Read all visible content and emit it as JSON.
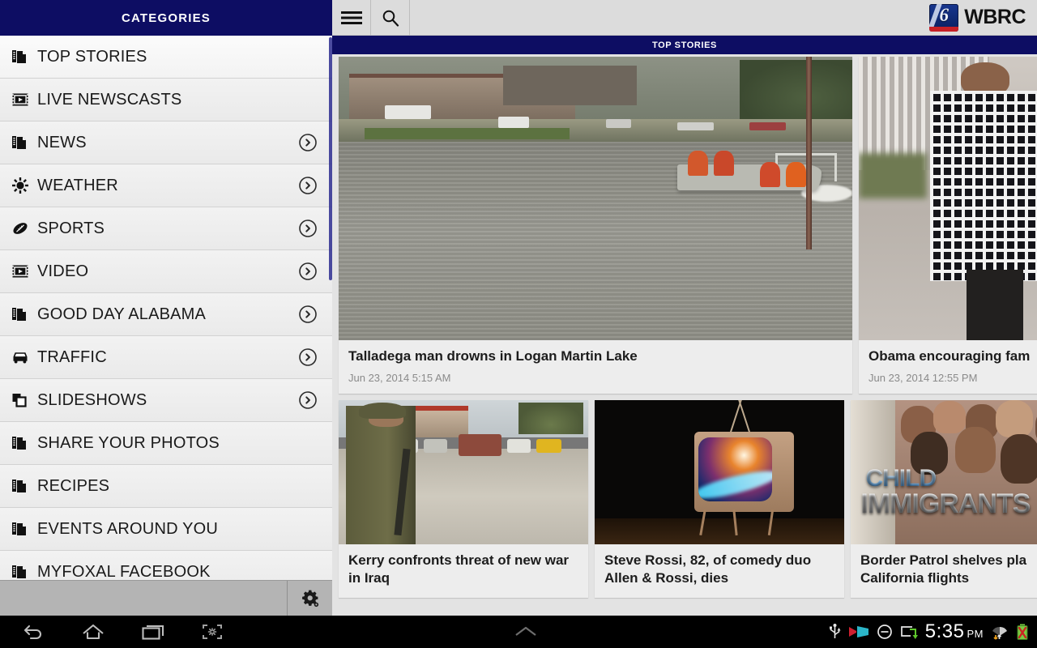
{
  "sidebar": {
    "header_title": "CATEGORIES",
    "settings_icon": "gear-icon",
    "items": [
      {
        "label": "TOP STORIES",
        "icon": "documents-icon",
        "chevron": false
      },
      {
        "label": "LIVE NEWSCASTS",
        "icon": "video-icon",
        "chevron": false
      },
      {
        "label": "NEWS",
        "icon": "documents-icon",
        "chevron": true
      },
      {
        "label": "WEATHER",
        "icon": "sun-icon",
        "chevron": true
      },
      {
        "label": "SPORTS",
        "icon": "football-icon",
        "chevron": true
      },
      {
        "label": "VIDEO",
        "icon": "video-icon",
        "chevron": true
      },
      {
        "label": "GOOD DAY ALABAMA",
        "icon": "documents-icon",
        "chevron": true
      },
      {
        "label": "TRAFFIC",
        "icon": "car-icon",
        "chevron": true
      },
      {
        "label": "SLIDESHOWS",
        "icon": "slideshow-icon",
        "chevron": true
      },
      {
        "label": "SHARE YOUR PHOTOS",
        "icon": "documents-icon",
        "chevron": false
      },
      {
        "label": "RECIPES",
        "icon": "documents-icon",
        "chevron": false
      },
      {
        "label": "EVENTS AROUND YOU",
        "icon": "documents-icon",
        "chevron": false
      },
      {
        "label": "MYFOXAL FACEBOOK",
        "icon": "documents-icon",
        "chevron": false
      }
    ]
  },
  "actionbar": {
    "menu_icon": "hamburger-menu-icon",
    "search_icon": "search-icon",
    "brand_mark": "6",
    "brand_name": "WBRC"
  },
  "section_bar": {
    "label": "TOP STORIES"
  },
  "feed": {
    "row1": [
      {
        "headline": "Talladega man drowns in Logan Martin Lake",
        "timestamp": "Jun 23, 2014 5:15 AM",
        "image": "rescue-boat-on-lake-photo"
      },
      {
        "headline": "Obama encouraging fam",
        "timestamp": "Jun 23, 2014 12:55 PM",
        "image": "obama-family-walking-photo"
      }
    ],
    "row2": [
      {
        "headline": "Kerry confronts threat of new war in Iraq",
        "timestamp": "",
        "image": "iraq-soldier-street-photo"
      },
      {
        "headline": "Steve Rossi, 82, of comedy duo Allen & Rossi, dies",
        "timestamp": "",
        "image": "retro-television-photo"
      },
      {
        "headline": "Border Patrol shelves pla California flights",
        "timestamp": "",
        "image": "child-immigrants-photo",
        "overlay_line1": "CHILD",
        "overlay_line2": "IMMIGRANTS"
      }
    ]
  },
  "navbar": {
    "back_icon": "back-arrow-icon",
    "home_icon": "home-icon",
    "recents_icon": "recent-apps-icon",
    "screenshot_icon": "screenshot-capture-icon",
    "expand_icon": "chevron-up-icon",
    "status_icons": [
      "usb-icon",
      "hdmi-cast-icon",
      "do-not-disturb-icon",
      "screen-share-icon"
    ],
    "clock_time": "5:35",
    "clock_period": "PM",
    "wifi_icon": "wifi-data-icon",
    "battery_icon": "battery-error-icon"
  },
  "colors": {
    "brand_navy": "#0d0d63",
    "brand_red": "#c62026",
    "sidebar_bg": "#ececec",
    "card_bg": "#ededed",
    "timestamp_gray": "#8a8a8a"
  }
}
